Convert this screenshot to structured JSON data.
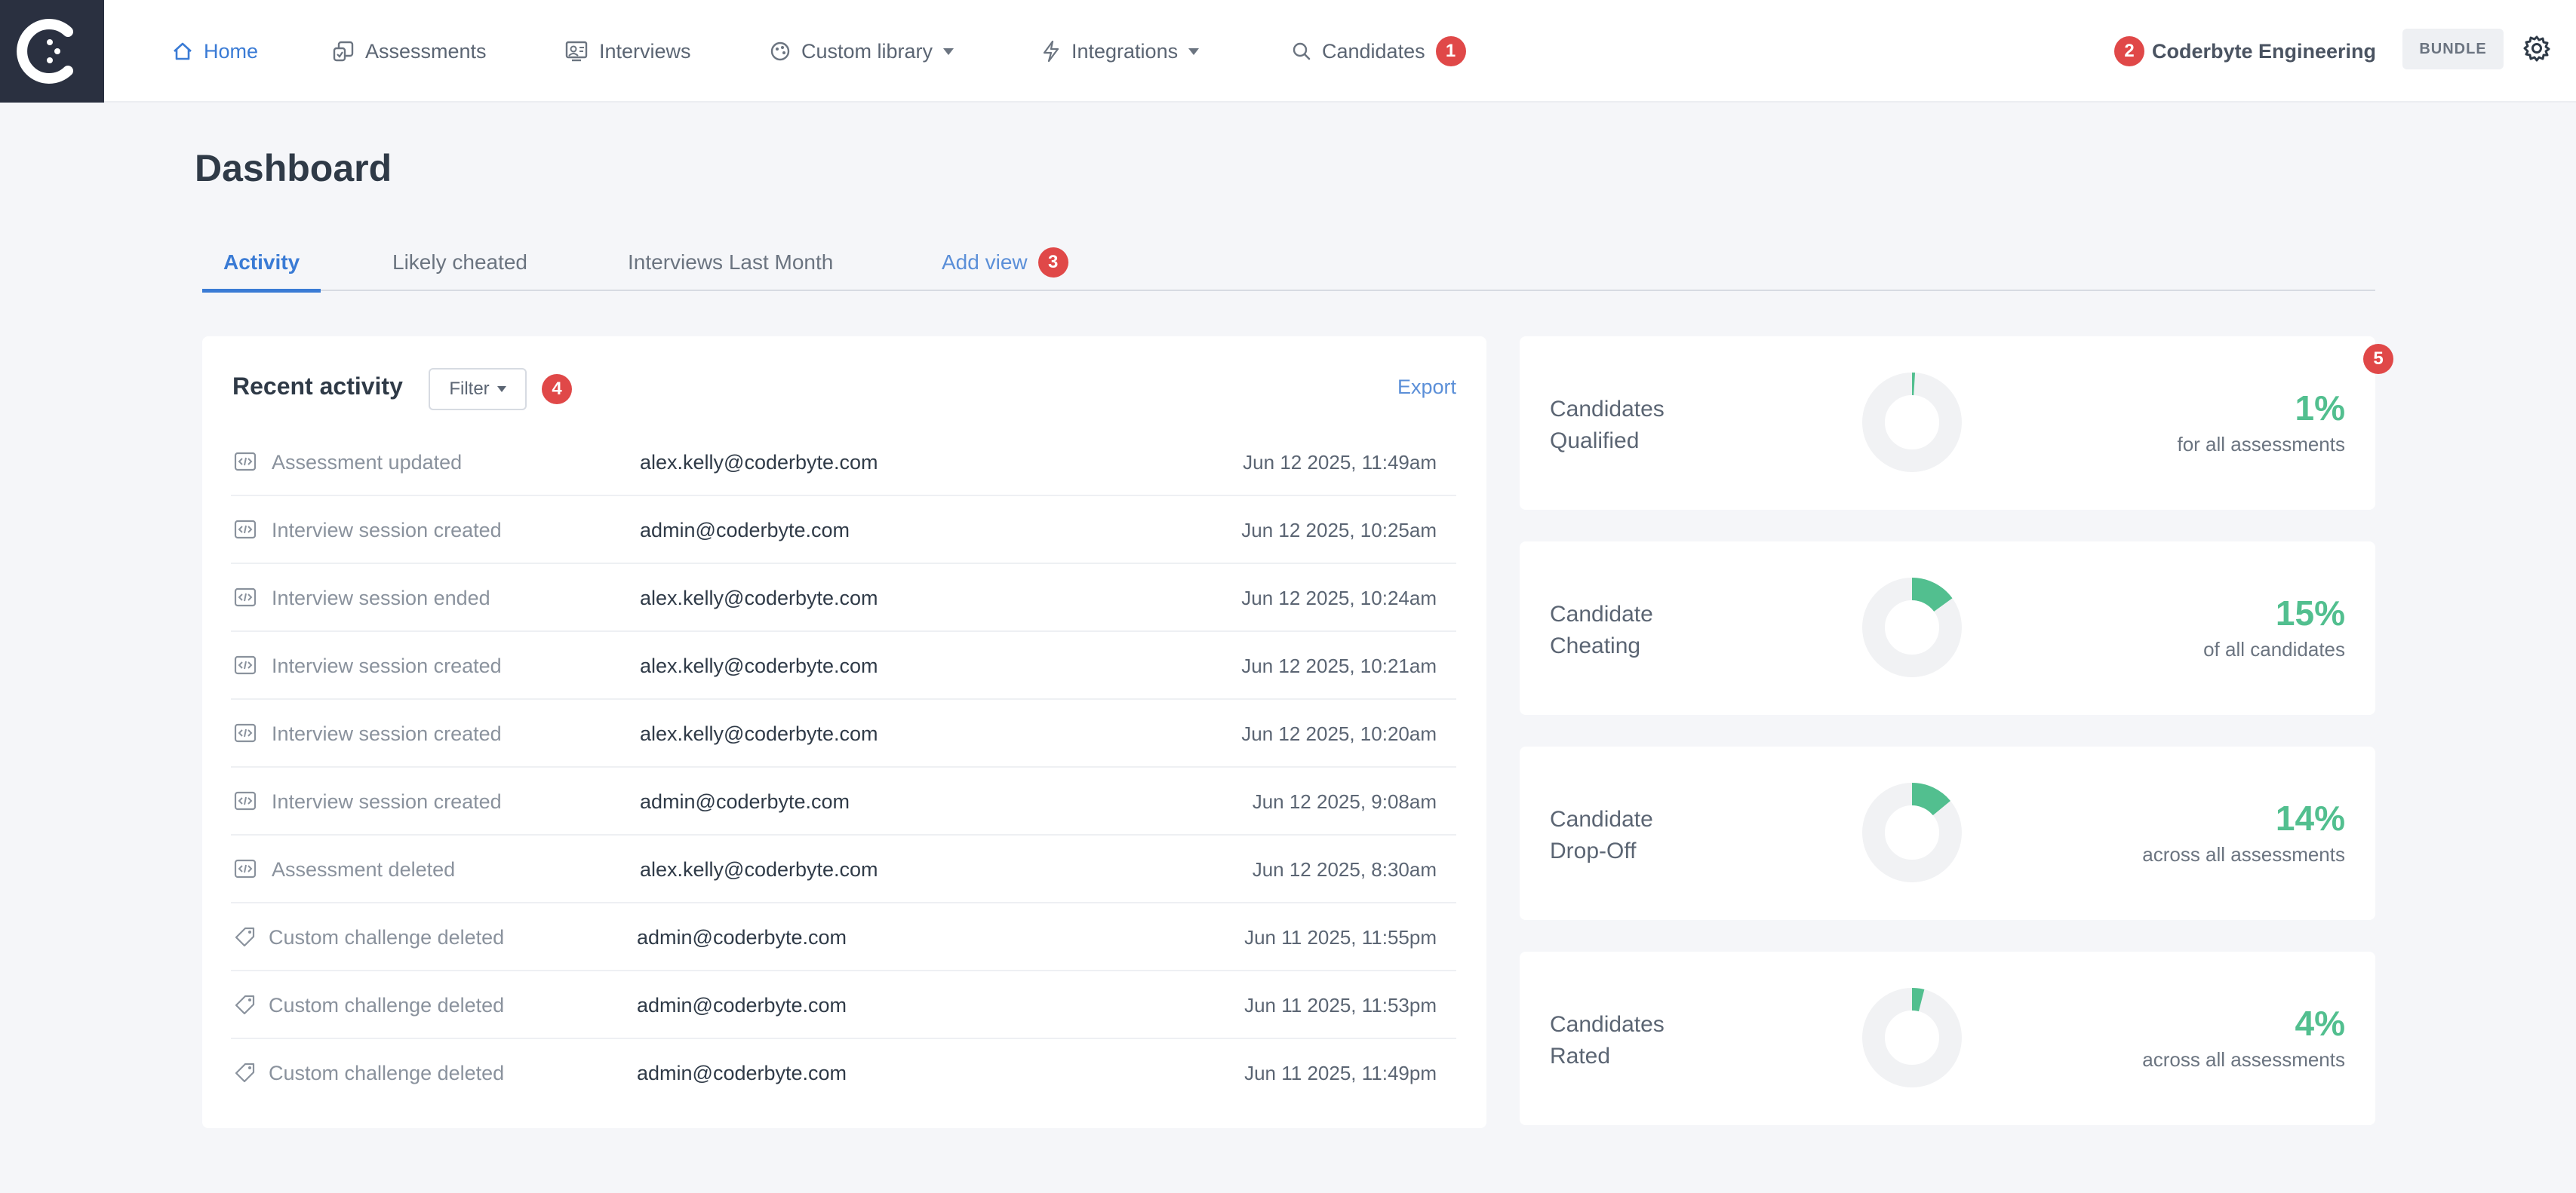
{
  "nav": {
    "items": [
      {
        "label": "Home",
        "icon": "home-icon",
        "active": true
      },
      {
        "label": "Assessments",
        "icon": "assessments-icon"
      },
      {
        "label": "Interviews",
        "icon": "interviews-icon"
      },
      {
        "label": "Custom library",
        "icon": "library-icon",
        "dropdown": true
      },
      {
        "label": "Integrations",
        "icon": "bolt-icon",
        "dropdown": true
      },
      {
        "label": "Candidates",
        "icon": "search-icon",
        "badge": "1"
      }
    ],
    "org_badge": "2",
    "org_name": "Coderbyte Engineering",
    "plan": "BUNDLE"
  },
  "page": {
    "title": "Dashboard",
    "tabs": [
      {
        "label": "Activity",
        "active": true
      },
      {
        "label": "Likely cheated"
      },
      {
        "label": "Interviews Last Month"
      },
      {
        "label": "Add view",
        "badge": "3"
      }
    ]
  },
  "activity": {
    "title": "Recent activity",
    "filter_label": "Filter",
    "filter_badge": "4",
    "export_label": "Export",
    "rows": [
      {
        "icon": "code-icon",
        "action": "Assessment updated",
        "user": "alex.kelly@coderbyte.com",
        "time": "Jun 12 2025, 11:49am"
      },
      {
        "icon": "code-icon",
        "action": "Interview session created",
        "user": "admin@coderbyte.com",
        "time": "Jun 12 2025, 10:25am"
      },
      {
        "icon": "code-icon",
        "action": "Interview session ended",
        "user": "alex.kelly@coderbyte.com",
        "time": "Jun 12 2025, 10:24am"
      },
      {
        "icon": "code-icon",
        "action": "Interview session created",
        "user": "alex.kelly@coderbyte.com",
        "time": "Jun 12 2025, 10:21am"
      },
      {
        "icon": "code-icon",
        "action": "Interview session created",
        "user": "alex.kelly@coderbyte.com",
        "time": "Jun 12 2025, 10:20am"
      },
      {
        "icon": "code-icon",
        "action": "Interview session created",
        "user": "admin@coderbyte.com",
        "time": "Jun 12 2025, 9:08am"
      },
      {
        "icon": "code-icon",
        "action": "Assessment deleted",
        "user": "alex.kelly@coderbyte.com",
        "time": "Jun 12 2025, 8:30am"
      },
      {
        "icon": "tag-icon",
        "action": "Custom challenge deleted",
        "user": "admin@coderbyte.com",
        "time": "Jun 11 2025, 11:55pm"
      },
      {
        "icon": "tag-icon",
        "action": "Custom challenge deleted",
        "user": "admin@coderbyte.com",
        "time": "Jun 11 2025, 11:53pm"
      },
      {
        "icon": "tag-icon",
        "action": "Custom challenge deleted",
        "user": "admin@coderbyte.com",
        "time": "Jun 11 2025, 11:49pm"
      }
    ]
  },
  "stats_badge": "5",
  "stats": [
    {
      "label_line1": "Candidates",
      "label_line2": "Qualified",
      "pct_text": "1%",
      "pct": 1,
      "sub": "for all assessments"
    },
    {
      "label_line1": "Candidate",
      "label_line2": "Cheating",
      "pct_text": "15%",
      "pct": 15,
      "sub": "of all candidates"
    },
    {
      "label_line1": "Candidate",
      "label_line2": "Drop-Off",
      "pct_text": "14%",
      "pct": 14,
      "sub": "across all assessments"
    },
    {
      "label_line1": "Candidates",
      "label_line2": "Rated",
      "pct_text": "4%",
      "pct": 4,
      "sub": "across all assessments"
    }
  ],
  "colors": {
    "accent": "#3a7bd5",
    "success": "#52bf8f",
    "badge": "#e04848",
    "logo_bg": "#2a3040"
  }
}
